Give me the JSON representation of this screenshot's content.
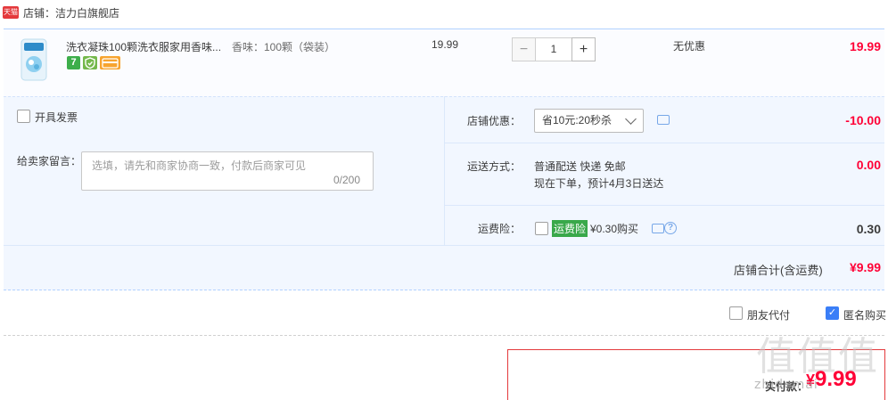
{
  "store": {
    "badge": "天猫",
    "label": "店铺：洁力白旗舰店"
  },
  "item": {
    "title": "洗衣凝珠100颗洗衣服家用香味...",
    "sku": "香味：100颗（袋装）",
    "thumb_icon": "detergent-bag-icon",
    "badges": [
      "7",
      "guarantee-icon",
      "card-icon"
    ],
    "unit_price": "19.99",
    "quantity": "1",
    "minus_label": "−",
    "plus_label": "+",
    "promotion": "无优惠",
    "subtotal": "19.99"
  },
  "invoice": {
    "label": "开具发票"
  },
  "message": {
    "label": "给卖家留言：",
    "placeholder": "选填，请先和商家协商一致，付款后商家可见",
    "counter": "0/200"
  },
  "shop_discount": {
    "label": "店铺优惠：",
    "selected": "省10元:20秒杀",
    "amount": "-10.00"
  },
  "shipping": {
    "label": "运送方式：",
    "method": "普通配送 快递 免邮",
    "eta": "现在下单，预计4月3日送达",
    "amount": "0.00"
  },
  "insurance": {
    "label": "运费险：",
    "tag": "运费险",
    "price": "¥0.30购买",
    "amount": "0.30"
  },
  "total": {
    "label": "店铺合计(含运费)",
    "amount": "¥9.99"
  },
  "options": {
    "friend_pay": "朋友代付",
    "anonymous": "匿名购买",
    "anonymous_checked": true
  },
  "pay": {
    "label": "实付款：",
    "currency": "¥",
    "amount": "9.99"
  },
  "watermark": {
    "big": "值值值",
    "small": "zhidemai"
  },
  "colors": {
    "accent_red": "#ff0036",
    "panel_bg": "#f2f7ff",
    "border_blue": "#b2d1ff",
    "insurance_green": "#39a84a",
    "checkbox_blue": "#3a7ef7"
  }
}
